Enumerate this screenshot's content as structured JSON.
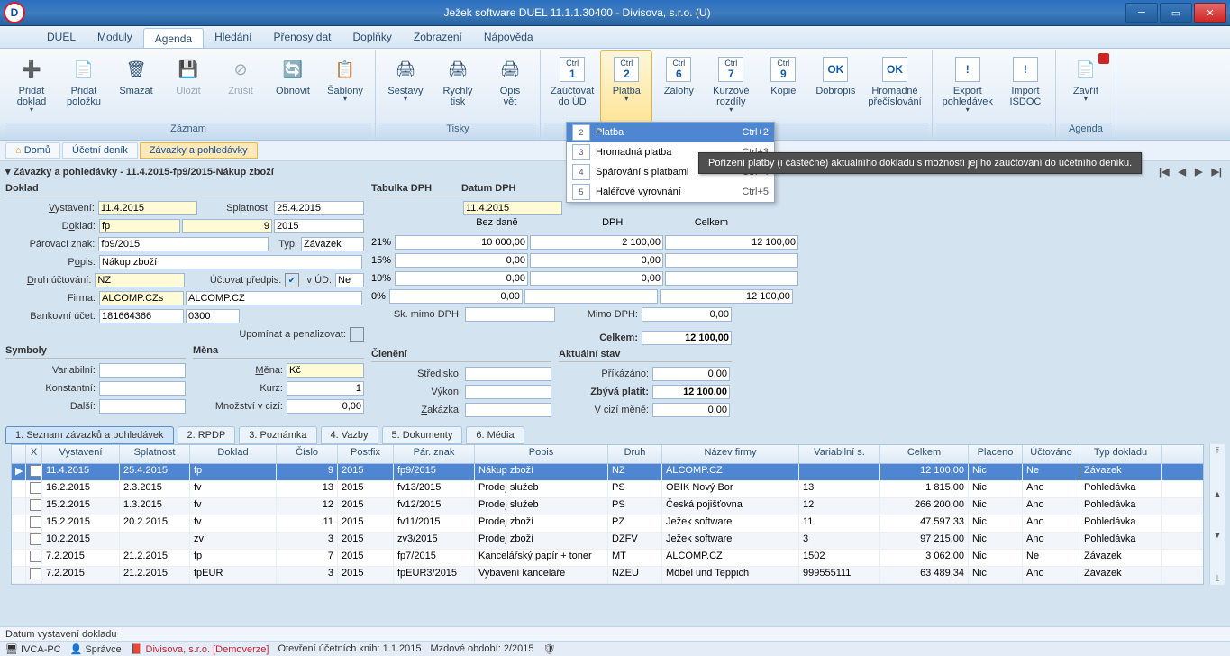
{
  "title": "Ježek software DUEL 11.1.1.30400 - Divisova, s.r.o. (U)",
  "menu": [
    "DUEL",
    "Moduly",
    "Agenda",
    "Hledání",
    "Přenosy dat",
    "Doplňky",
    "Zobrazení",
    "Nápověda"
  ],
  "ribbon": {
    "groups": [
      {
        "label": "Záznam",
        "items": [
          {
            "name": "pridat-doklad",
            "label": "Přidat doklad",
            "dd": "▾",
            "icon": "➕"
          },
          {
            "name": "pridat-polozku",
            "label": "Přidat položku",
            "icon": "📄"
          },
          {
            "name": "smazat",
            "label": "Smazat",
            "icon": "🗑"
          },
          {
            "name": "ulozit",
            "label": "Uložit",
            "icon": "💾",
            "disabled": true
          },
          {
            "name": "zrusit",
            "label": "Zrušit",
            "icon": "⊘",
            "disabled": true
          },
          {
            "name": "obnovit",
            "label": "Obnovit",
            "icon": "🔄"
          },
          {
            "name": "sablony",
            "label": "Šablony",
            "dd": "▾",
            "icon": "📋"
          }
        ]
      },
      {
        "label": "Tisky",
        "items": [
          {
            "name": "sestavy",
            "label": "Sestavy",
            "dd": "▾",
            "icon": "🖨"
          },
          {
            "name": "rychly-tisk",
            "label": "Rychlý tisk",
            "icon": "🖨"
          },
          {
            "name": "opis-vet",
            "label": "Opis vět",
            "icon": "🖨"
          }
        ]
      },
      {
        "label": "",
        "items": [
          {
            "name": "zauctovat",
            "label": "Zaúčtovat do ÚD",
            "key": "1",
            "ctrl": "Ctrl"
          },
          {
            "name": "platba",
            "label": "Platba",
            "dd": "▾",
            "key": "2",
            "ctrl": "Ctrl",
            "active": true
          },
          {
            "name": "zalohy",
            "label": "Zálohy",
            "key": "6",
            "ctrl": "Ctrl"
          },
          {
            "name": "kurzove",
            "label": "Kurzové rozdíly",
            "dd": "▾",
            "key": "7",
            "ctrl": "Ctrl"
          },
          {
            "name": "kopie",
            "label": "Kopie",
            "key": "9",
            "ctrl": "Ctrl"
          },
          {
            "name": "dobropis",
            "label": "Dobropis",
            "key": "OK"
          },
          {
            "name": "hromadne",
            "label": "Hromadné přečíslování",
            "key": "OK"
          }
        ]
      },
      {
        "label": "",
        "items": [
          {
            "name": "export",
            "label": "Export pohledávek",
            "dd": "▾",
            "key": "!"
          },
          {
            "name": "import",
            "label": "Import ISDOC",
            "key": "!"
          }
        ]
      },
      {
        "label": "Agenda",
        "items": [
          {
            "name": "zavrit",
            "label": "Zavřít",
            "dd": "▾",
            "icon": "📄",
            "close": true
          }
        ]
      }
    ]
  },
  "breadcrumb": [
    "Domů",
    "Účetní deník",
    "Závazky a pohledávky"
  ],
  "subtitle": "Závazky a pohledávky - 11.4.2015-fp9/2015-Nákup zboží",
  "doklad": {
    "title": "Doklad",
    "vystaveni_lbl": "Vystavení:",
    "vystaveni": "11.4.2015",
    "splatnost_lbl": "Splatnost:",
    "splatnost": "25.4.2015",
    "doklad_lbl": "Doklad:",
    "doklad_a": "fp",
    "doklad_b": "9",
    "doklad_c": "2015",
    "parznak_lbl": "Párovací znak:",
    "parznak": "fp9/2015",
    "typ_lbl": "Typ:",
    "typ": "Závazek",
    "popis_lbl": "Popis:",
    "popis": "Nákup zboží",
    "druh_lbl": "Druh účtování:",
    "druh": "NZ",
    "uctpred_lbl": "Účtovat předpis:",
    "vud_lbl": "v ÚD:",
    "vud": "Ne",
    "firma_lbl": "Firma:",
    "firma_a": "ALCOMP.CZs",
    "firma_b": "ALCOMP.CZ",
    "bank_lbl": "Bankovní účet:",
    "bank_a": "181664366",
    "bank_b": "0300",
    "upominat": "Upomínat a penalizovat:"
  },
  "symboly": {
    "title": "Symboly",
    "var_lbl": "Variabilní:",
    "konst_lbl": "Konstantní:",
    "dalsi_lbl": "Další:"
  },
  "mena": {
    "title": "Měna",
    "mena_lbl": "Měna:",
    "mena": "Kč",
    "kurz_lbl": "Kurz:",
    "kurz": "1",
    "mnozstvi_lbl": "Množství v cizí:",
    "mnozstvi": "0,00"
  },
  "cleneni": {
    "title": "Členění",
    "str_lbl": "Středisko:",
    "vyk_lbl": "Výkon:",
    "zak_lbl": "Zakázka:"
  },
  "dph": {
    "title": "Tabulka DPH",
    "datum_lbl": "Datum DPH",
    "datum": "11.4.2015",
    "hdr": [
      "Bez daně",
      "DPH",
      "Celkem"
    ],
    "rows": [
      {
        "sazba": "21%",
        "bez": "10 000,00",
        "dph": "2 100,00",
        "cel": "12 100,00"
      },
      {
        "sazba": "15%",
        "bez": "0,00",
        "dph": "0,00",
        "cel": ""
      },
      {
        "sazba": "10%",
        "bez": "0,00",
        "dph": "0,00",
        "cel": ""
      },
      {
        "sazba": "0%",
        "bez": "0,00",
        "dph": "",
        "cel": "12 100,00"
      }
    ],
    "sk_lbl": "Sk. mimo DPH:",
    "mimo_lbl": "Mimo DPH:",
    "mimo": "0,00",
    "celkem_lbl": "Celkem:",
    "celkem": "12 100,00"
  },
  "stav": {
    "title": "Aktuální stav",
    "prik_lbl": "Příkázáno:",
    "prik": "0,00",
    "zbyva_lbl": "Zbývá platit:",
    "zbyva": "12 100,00",
    "cizi_lbl": "V cizí měně:",
    "cizi": "0,00"
  },
  "skupina_lbl": "Sk",
  "dropdown": [
    {
      "key": "2",
      "label": "Platba",
      "sc": "Ctrl+2",
      "hl": true
    },
    {
      "key": "3",
      "label": "Hromadná platba",
      "sc": "Ctrl+3"
    },
    {
      "key": "4",
      "label": "Spárování s platbami",
      "sc": "Ctrl+4"
    },
    {
      "key": "5",
      "label": "Haléřové vyrovnání",
      "sc": "Ctrl+5"
    }
  ],
  "tooltip": "Pořízení platby (i částečné) aktuálního dokladu s možností jejího zaúčtování do účetního deníku.",
  "gridTabs": [
    "1. Seznam závazků a pohledávek",
    "2. RPDP",
    "3. Poznámka",
    "4. Vazby",
    "5. Dokumenty",
    "6. Média"
  ],
  "gridHeaders": [
    "",
    "X",
    "Vystavení",
    "Splatnost",
    "Doklad",
    "Číslo",
    "Postfix",
    "Pár. znak",
    "Popis",
    "Druh",
    "Název firmy",
    "Variabilní s.",
    "Celkem",
    "Placeno",
    "Účtováno",
    "Typ dokladu"
  ],
  "gridWidths": [
    16,
    18,
    86,
    78,
    96,
    68,
    62,
    90,
    148,
    60,
    152,
    90,
    98,
    60,
    64,
    90
  ],
  "gridRows": [
    {
      "sel": true,
      "c": [
        "",
        "",
        "11.4.2015",
        "25.4.2015",
        "fp",
        "9",
        "2015",
        "fp9/2015",
        "Nákup zboží",
        "NZ",
        "ALCOMP.CZ",
        "",
        "12 100,00",
        "Nic",
        "Ne",
        "Závazek"
      ]
    },
    {
      "c": [
        "",
        "",
        "16.2.2015",
        "2.3.2015",
        "fv",
        "13",
        "2015",
        "fv13/2015",
        "Prodej služeb",
        "PS",
        "OBIK Nový Bor",
        "13",
        "1 815,00",
        "Nic",
        "Ano",
        "Pohledávka"
      ]
    },
    {
      "alt": true,
      "c": [
        "",
        "",
        "15.2.2015",
        "1.3.2015",
        "fv",
        "12",
        "2015",
        "fv12/2015",
        "Prodej služeb",
        "PS",
        "Česká pojišťovna",
        "12",
        "266 200,00",
        "Nic",
        "Ano",
        "Pohledávka"
      ]
    },
    {
      "c": [
        "",
        "",
        "15.2.2015",
        "20.2.2015",
        "fv",
        "11",
        "2015",
        "fv11/2015",
        "Prodej zboží",
        "PZ",
        "Ježek software",
        "11",
        "47 597,33",
        "Nic",
        "Ano",
        "Pohledávka"
      ]
    },
    {
      "alt": true,
      "c": [
        "",
        "",
        "10.2.2015",
        "",
        "zv",
        "3",
        "2015",
        "zv3/2015",
        "Prodej zboží",
        "DZFV",
        "Ježek software",
        "3",
        "97 215,00",
        "Nic",
        "Ano",
        "Pohledávka"
      ]
    },
    {
      "c": [
        "",
        "",
        "7.2.2015",
        "21.2.2015",
        "fp",
        "7",
        "2015",
        "fp7/2015",
        "Kancelářský papír + toner",
        "MT",
        "ALCOMP.CZ",
        "1502",
        "3 062,00",
        "Nic",
        "Ne",
        "Závazek"
      ]
    },
    {
      "alt": true,
      "c": [
        "",
        "",
        "7.2.2015",
        "21.2.2015",
        "fpEUR",
        "3",
        "2015",
        "fpEUR3/2015",
        "Vybavení kanceláře",
        "NZEU",
        "Möbel und Teppich",
        "999555111",
        "63 489,34",
        "Nic",
        "Ano",
        "Závazek"
      ]
    }
  ],
  "status1": "Datum vystavení dokladu",
  "status2": {
    "pc": "IVCA-PC",
    "spr": "Správce",
    "demo": "Divisova, s.r.o. [Demoverze]",
    "knihy": "Otevření účetních knih: 1.1.2015",
    "mzdy": "Mzdové období: 2/2015"
  }
}
